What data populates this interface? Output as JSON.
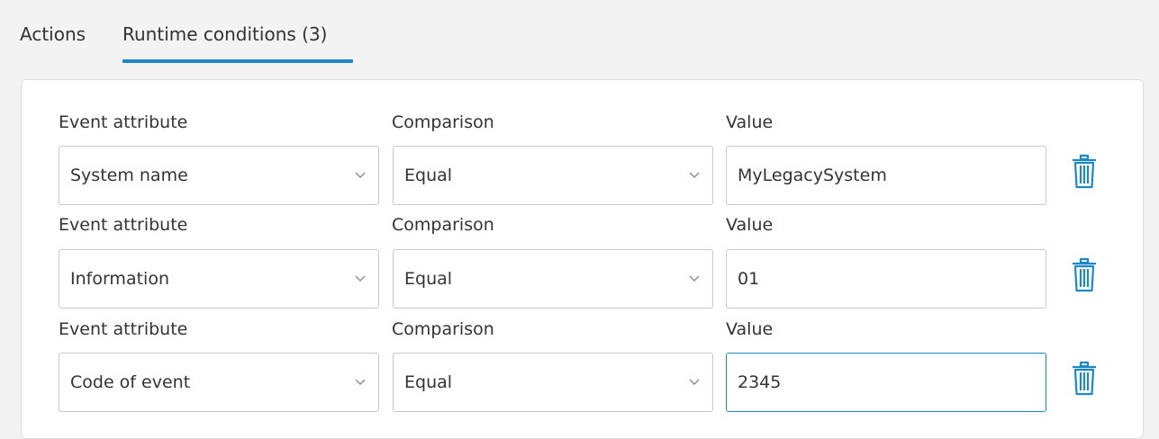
{
  "tabs": [
    {
      "label": "Actions",
      "active": false
    },
    {
      "label": "Runtime conditions (3)",
      "active": true
    }
  ],
  "labels": {
    "attribute": "Event attribute",
    "comparison": "Comparison",
    "value": "Value"
  },
  "conditions": [
    {
      "attribute": "System name",
      "comparison": "Equal",
      "value": "MyLegacySystem"
    },
    {
      "attribute": "Information",
      "comparison": "Equal",
      "value": "01"
    },
    {
      "attribute": "Code of event",
      "comparison": "Equal",
      "value": "2345"
    }
  ],
  "icons": {
    "dropdown": "chevron-down-icon",
    "delete": "trash-icon"
  },
  "colors": {
    "accent": "#1e88c7",
    "border": "#c8c8c8",
    "background": "#f3f3f3",
    "panel": "#ffffff"
  }
}
